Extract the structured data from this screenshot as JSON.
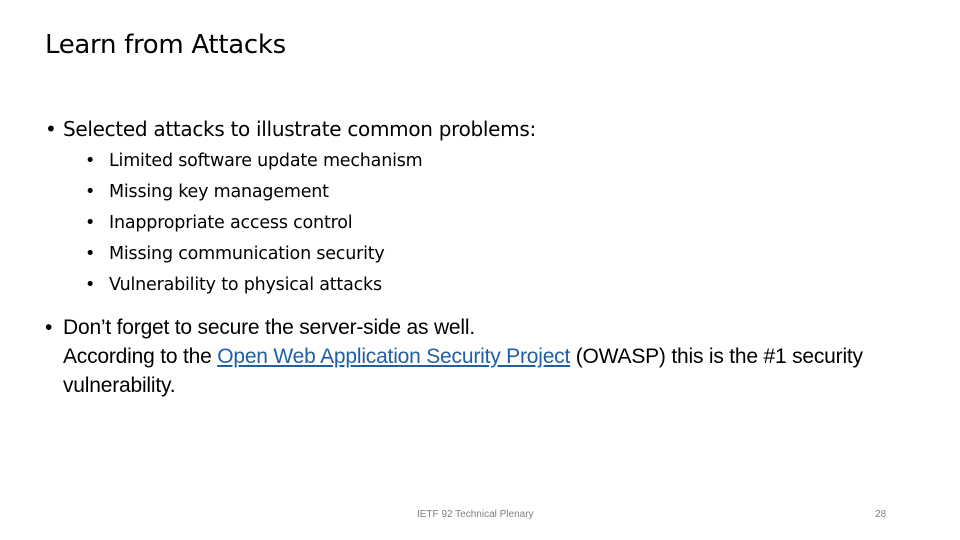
{
  "slide": {
    "title": "Learn from Attacks",
    "bullets": [
      {
        "text": "Selected attacks to illustrate common problems:",
        "sub_items": [
          "Limited software update mechanism",
          "Missing key management",
          "Inappropriate access control",
          "Missing communication security",
          "Vulnerability to physical attacks"
        ]
      },
      {
        "line1": "Don’t forget to secure the server-side as well.",
        "prefix": "According to the ",
        "link_text": "Open Web Application Security Project",
        "suffix": " (OWASP) this is the #1 security vulnerability."
      }
    ],
    "bullet_glyph": "•",
    "link_color": "#1f5fa6"
  },
  "footer": {
    "center_text": "IETF 92 Technical Plenary",
    "page_number": "28"
  }
}
